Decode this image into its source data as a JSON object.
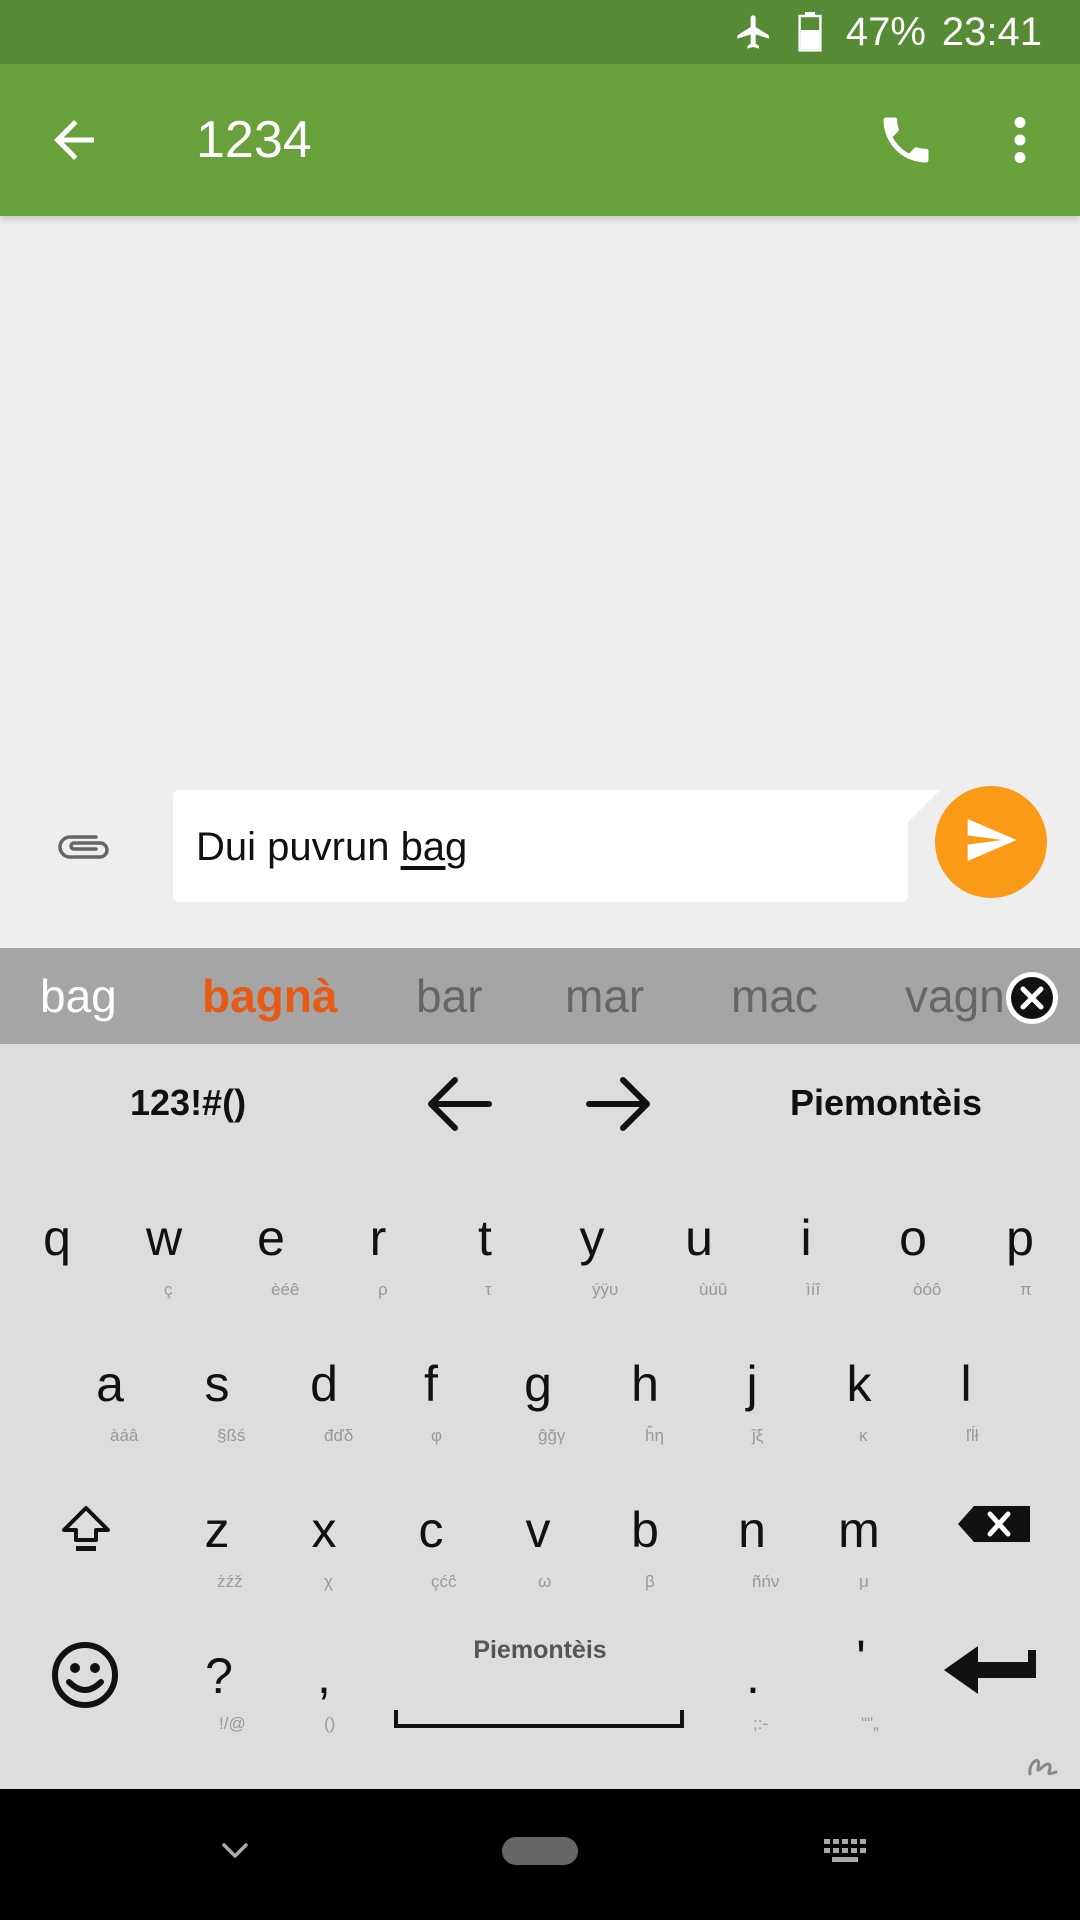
{
  "status_bar": {
    "battery": "47%",
    "time": "23:41",
    "icons": [
      "airplane-mode-icon",
      "battery-icon"
    ]
  },
  "toolbar": {
    "title": "1234",
    "icons": [
      "back-arrow-icon",
      "phone-icon",
      "more-vert-icon"
    ]
  },
  "compose": {
    "committed_text": "Dui puvrun ",
    "composing_text": "bag",
    "icons": [
      "paperclip-icon",
      "send-icon"
    ]
  },
  "suggestions": [
    {
      "text": "bag",
      "color": "#ffffff",
      "bold": false
    },
    {
      "text": "bagnà",
      "color": "#e65a14",
      "bold": true
    },
    {
      "text": "bar",
      "color": "#666666",
      "bold": false
    },
    {
      "text": "mar",
      "color": "#666666",
      "bold": false
    },
    {
      "text": "mac",
      "color": "#666666",
      "bold": false
    },
    {
      "text": "vagn",
      "color": "#666666",
      "bold": false
    }
  ],
  "keyboard": {
    "symbols_label": "123!#()",
    "language_label": "Piemontèis",
    "space_label": "Piemontèis",
    "row1": [
      {
        "main": "q",
        "sub": ""
      },
      {
        "main": "w",
        "sub": "ç"
      },
      {
        "main": "e",
        "sub": "èéê"
      },
      {
        "main": "r",
        "sub": "ρ"
      },
      {
        "main": "t",
        "sub": "τ"
      },
      {
        "main": "y",
        "sub": "ýÿυ"
      },
      {
        "main": "u",
        "sub": "ùúû"
      },
      {
        "main": "i",
        "sub": "ìíî"
      },
      {
        "main": "o",
        "sub": "òóô"
      },
      {
        "main": "p",
        "sub": "π"
      }
    ],
    "row2": [
      {
        "main": "a",
        "sub": "àáâ"
      },
      {
        "main": "s",
        "sub": "§ßś"
      },
      {
        "main": "d",
        "sub": "đďδ"
      },
      {
        "main": "f",
        "sub": "φ"
      },
      {
        "main": "g",
        "sub": "ĝğγ"
      },
      {
        "main": "h",
        "sub": "ĥη"
      },
      {
        "main": "j",
        "sub": "ĵξ"
      },
      {
        "main": "k",
        "sub": "κ"
      },
      {
        "main": "l",
        "sub": "ľĺł"
      }
    ],
    "row3": [
      {
        "main": "z",
        "sub": "żźž"
      },
      {
        "main": "x",
        "sub": "χ"
      },
      {
        "main": "c",
        "sub": "çćĉ"
      },
      {
        "main": "v",
        "sub": "ω"
      },
      {
        "main": "b",
        "sub": "β"
      },
      {
        "main": "n",
        "sub": "ñńν"
      },
      {
        "main": "m",
        "sub": "μ"
      }
    ],
    "row4": [
      {
        "main": "?",
        "sub": "!/@"
      },
      {
        "main": ",",
        "sub": "()"
      },
      {
        "main": ".",
        "sub": ";:-"
      },
      {
        "main": "'",
        "sub": "\"\"„"
      }
    ],
    "icons": [
      "left-arrow-icon",
      "right-arrow-icon",
      "shift-icon",
      "backspace-icon",
      "emoji-icon",
      "enter-icon",
      "close-suggestions-icon",
      "swype-icon"
    ]
  },
  "nav_bar": {
    "icons": [
      "hide-keyboard-icon",
      "home-pill-icon",
      "keyboard-switch-icon"
    ]
  }
}
